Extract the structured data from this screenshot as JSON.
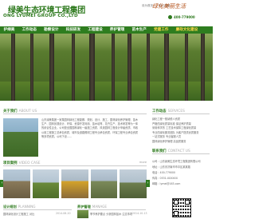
{
  "header": {
    "logo_cn": "绿美生态环境工程集团",
    "logo_en": "ONG LYUMEI GROUP CO.,LTD",
    "top_links": [
      "设为首页",
      "加入收藏"
    ],
    "slogan": "绿化美丽生活",
    "phone": "400-779000"
  },
  "nav": {
    "items": [
      "护绿美",
      "工作动态",
      "勘察设计",
      "科技研发",
      "工程建设",
      "养护管理",
      "苗木生产",
      "党建工作",
      "廉政文化建设"
    ]
  },
  "banner": {
    "sign": "绿化美丽生活"
  },
  "about": {
    "title": "关于我们",
    "title_en": "ABOUT US",
    "more": "more",
    "text": "山东绿美集团一家集园林绿化工程勘察、规划、设计、施工、园林绿化养护管理、苗木生产、园林景观设计、环保、资源开发利用、苗木培育、花卉生产、技术研发等为一体的综合性企业。公司是全国园林绿化一级施工资质、风景园林工程设计甲级资质、市政公用工程施工总承包资质、城市及道路照明工程专业承包资质、环保工程专业承包资质等多项资质。公司下设……"
  },
  "services": {
    "title": "工作动态",
    "title_en": "SERVICES",
    "items": [
      "绿化工程一般纳税人资质",
      "严格的绿化质量标准 保证养护质量",
      "采用科学的 工艺技术保障工程绿化质量",
      "专业的绿化服务团队 为客户提供优质服务",
      "一站式服务 专业客服人员",
      "园林绿化养护管理 高品质服务"
    ]
  },
  "cases": {
    "title": "项目案例",
    "title_en": "VIDEO CASE",
    "more": "more"
  },
  "contact": {
    "title": "联系我们",
    "title_en": "CONTACT US",
    "lines": [
      "公司：山东绿美生态环境工程集团有限公司",
      "地址：山东省济南市市中区某某路",
      "电话：400-779000",
      "传真：0531-XXXXXX",
      "邮箱：lymei@163.com"
    ]
  },
  "news": [
    {
      "title": "设计规划",
      "title_en": "PLANNING",
      "line": "园林绿化设计工程施工 对比",
      "date": "2014-08-20"
    },
    {
      "title": "养护管理",
      "title_en": "MANAGE",
      "line": "季节养护要点 分析园林苗木 注意事项",
      "date": "2014-10-13"
    }
  ]
}
